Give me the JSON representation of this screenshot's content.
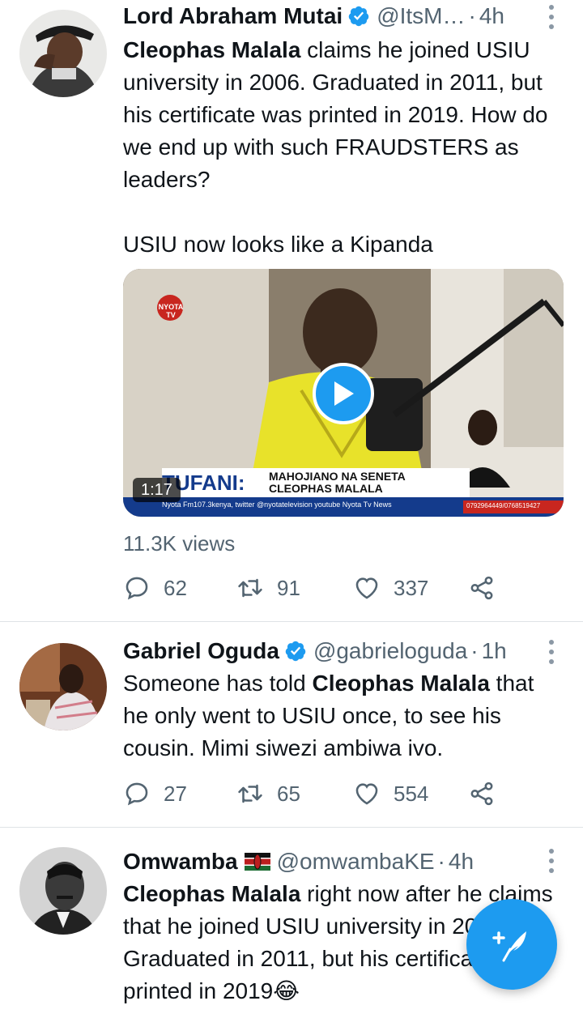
{
  "tweets": [
    {
      "name": "Lord Abraham Mutai",
      "handle": "@ItsM…",
      "time": "4h",
      "body_bold": "Cleophas Malala",
      "body_rest": " claims he joined USIU university in 2006. Graduated in 2011, but his certificate was printed in 2019. How do we end up with such FRAUDSTERS as leaders?\n\nUSIU now looks like a Kipanda",
      "video": {
        "duration": "1:17",
        "channel_logo": "NYOTA TV",
        "lower_third_title": "TUFANI:",
        "lower_third_line1": "MAHOJIANO NA SENETA",
        "lower_third_line2": "CLEOPHAS MALALA",
        "ticker": "Nyota Fm107.3kenya, twitter @nyotatelevision youtube Nyota Tv News",
        "phone": "0792964449/0768519427"
      },
      "views": "11.3K views",
      "replies": "62",
      "retweets": "91",
      "likes": "337"
    },
    {
      "name": "Gabriel Oguda",
      "handle": "@gabrieloguda",
      "time": "1h",
      "body_pre": "Someone has told ",
      "body_bold": "Cleophas Malala",
      "body_rest": " that he only went to USIU once, to see his cousin. Mimi siwezi ambiwa ivo.",
      "replies": "27",
      "retweets": "65",
      "likes": "554"
    },
    {
      "name": "Omwamba",
      "handle": "@omwambaKE",
      "time": "4h",
      "body_bold": "Cleophas Malala",
      "body_rest": " right now after he claims that he joined USIU university in 2006 and  Graduated in 2011, but his certificate was printed in 2019😂"
    }
  ],
  "separator": "·",
  "colors": {
    "accent": "#1d9bf0",
    "secondary_text": "#536471",
    "divider": "#dfe3e6"
  },
  "icons": [
    "verified-badge-icon",
    "more-options-icon",
    "reply-icon",
    "retweet-icon",
    "like-icon",
    "share-icon",
    "play-icon",
    "compose-tweet-icon",
    "kenya-flag-icon"
  ]
}
